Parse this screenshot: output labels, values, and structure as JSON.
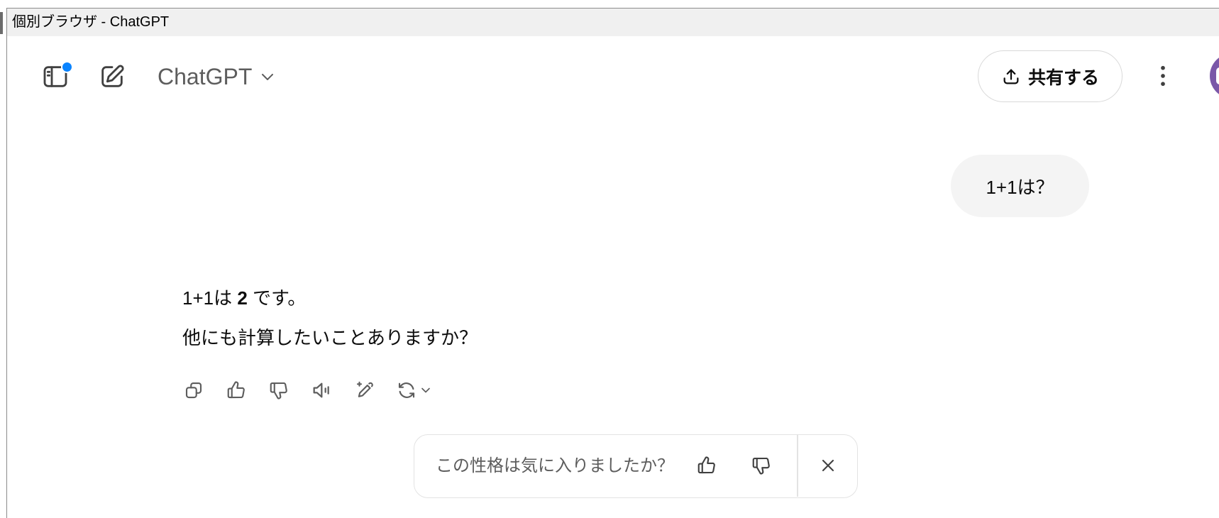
{
  "window": {
    "title": "個別ブラウザ - ChatGPT"
  },
  "header": {
    "sidebar_toggle": {
      "icon": "sidebar-icon",
      "has_notification_dot": true
    },
    "new_chat": {
      "icon": "edit-icon"
    },
    "model_selector": {
      "label": "ChatGPT",
      "icon": "chevron-down-icon"
    },
    "share": {
      "label": "共有する",
      "icon": "share-upload-icon"
    },
    "more": {
      "icon": "more-vertical-icon"
    },
    "avatar": {
      "icon": "avatar"
    }
  },
  "conversation": {
    "user_message": "1+1は？",
    "assistant_message": {
      "line1": {
        "before": "1+1は ",
        "bold": "2",
        "after": " です。"
      },
      "line2": "他にも計算したいことありますか？"
    },
    "actions": [
      {
        "icon": "copy-icon"
      },
      {
        "icon": "thumbs-up-icon"
      },
      {
        "icon": "thumbs-down-icon"
      },
      {
        "icon": "speaker-icon"
      },
      {
        "icon": "edit-sparkle-icon"
      },
      {
        "icon": "refresh-icon",
        "has_dropdown": true
      }
    ]
  },
  "feedback": {
    "question": "この性格は気に入りましたか？",
    "like_icon": "thumbs-up-icon",
    "dislike_icon": "thumbs-down-icon",
    "close_icon": "close-icon"
  },
  "colors": {
    "notification_dot": "#0a84ff",
    "bubble_background": "#f4f4f4",
    "text": "#0d0d0d",
    "muted_text": "#5d5d5d",
    "border": "#e3e3e3",
    "avatar": "#7a57a8"
  }
}
